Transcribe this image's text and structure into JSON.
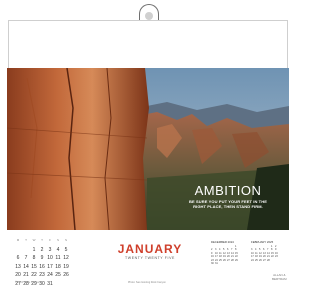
{
  "photo": {
    "title": "AMBITION",
    "quote": "BE SURE YOU PUT YOUR FEET IN THE RIGHT PLACE, THEN STAND FIRM."
  },
  "month": {
    "name": "JANUARY",
    "year": "TWENTY TWENTY FIVE"
  },
  "calendar": {
    "weekdays": [
      "M",
      "T",
      "W",
      "T",
      "F",
      "S",
      "S"
    ],
    "weeks": [
      [
        "",
        "",
        "1",
        "2",
        "3",
        "4",
        "5"
      ],
      [
        "6",
        "7",
        "8",
        "9",
        "10",
        "11",
        "12"
      ],
      [
        "13",
        "14",
        "15",
        "16",
        "17",
        "18",
        "19"
      ],
      [
        "20",
        "21",
        "22",
        "23",
        "24",
        "25",
        "26"
      ],
      [
        "27",
        "28",
        "29",
        "30",
        "31",
        "",
        ""
      ]
    ]
  },
  "mini_prev": {
    "title": "DECEMBER 2024",
    "weeks": [
      [
        "",
        "",
        "",
        "",
        "",
        "",
        "1"
      ],
      [
        "2",
        "3",
        "4",
        "5",
        "6",
        "7",
        "8"
      ],
      [
        "9",
        "10",
        "11",
        "12",
        "13",
        "14",
        "15"
      ],
      [
        "16",
        "17",
        "18",
        "19",
        "20",
        "21",
        "22"
      ],
      [
        "23",
        "24",
        "25",
        "26",
        "27",
        "28",
        "29"
      ],
      [
        "30",
        "31",
        "",
        "",
        "",
        "",
        ""
      ]
    ]
  },
  "mini_next": {
    "title": "FEBRUARY 2025",
    "weeks": [
      [
        "",
        "",
        "",
        "",
        "",
        "1",
        "2"
      ],
      [
        "3",
        "4",
        "5",
        "6",
        "7",
        "8",
        "9"
      ],
      [
        "10",
        "11",
        "12",
        "13",
        "14",
        "15",
        "16"
      ],
      [
        "17",
        "18",
        "19",
        "20",
        "21",
        "22",
        "23"
      ],
      [
        "24",
        "25",
        "26",
        "27",
        "28",
        "",
        ""
      ]
    ]
  },
  "footer": {
    "caption": "Photo: Sao Gorotng Rock Canyon",
    "left_note": "© 2024 Some Company",
    "brand_line1": "ALLAN &",
    "brand_line2": "BERTRAM"
  }
}
